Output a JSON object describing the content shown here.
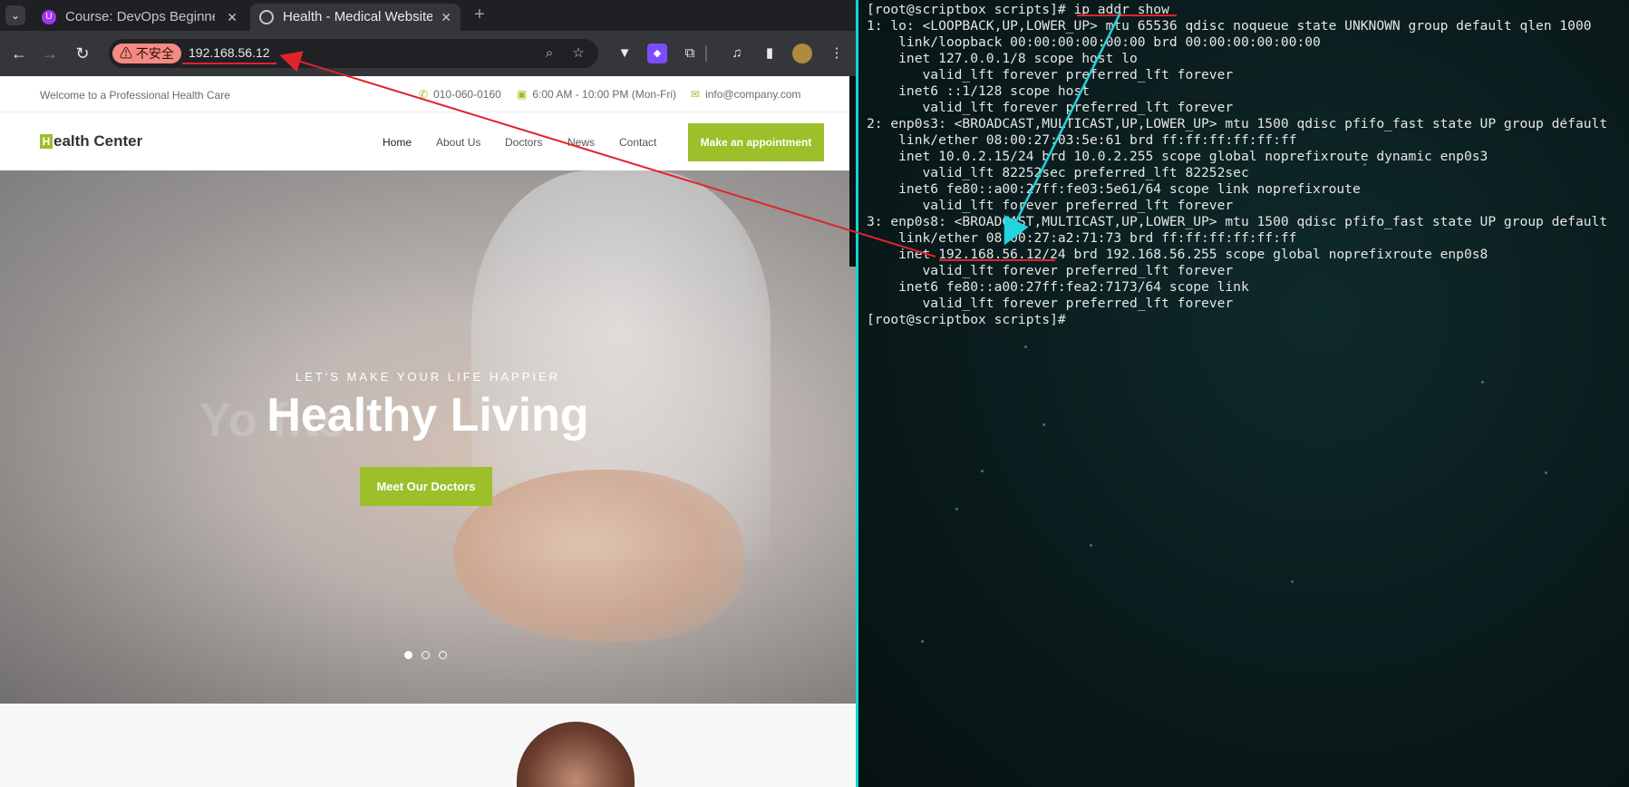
{
  "browser": {
    "tab_menu_icon": "chevron-down-icon",
    "tabs": [
      {
        "title": "Course: DevOps Beginne",
        "favicon": "udemy-icon",
        "close": "✕"
      },
      {
        "title": "Health - Medical Website",
        "favicon": "globe-icon",
        "close": "✕"
      }
    ],
    "new_tab_label": "+",
    "toolbar": {
      "back_icon": "←",
      "forward_icon": "→",
      "reload_icon": "↻",
      "security_label": "⚠ 不安全",
      "url": "192.168.56.12",
      "zoom_icon": "🔍",
      "bookmark_icon": "☆",
      "menu_icon": "⋮"
    }
  },
  "site": {
    "topbar": {
      "welcome": "Welcome to a Professional Health Care",
      "phone": "010-060-0160",
      "hours": "6:00 AM - 10:00 PM (Mon-Fri)",
      "email": "info@company.com"
    },
    "nav": {
      "brand_letter": "H",
      "brand_rest": "ealth Center",
      "links": [
        "Home",
        "About Us",
        "Doctors",
        "News",
        "Contact"
      ],
      "cta": "Make an appointment"
    },
    "hero": {
      "subtitle": "LET'S MAKE YOUR LIFE HAPPIER",
      "title": "Healthy Living",
      "ghost_text": "Yo                                  fits",
      "button": "Meet Our Doctors",
      "slides": 3,
      "active_slide": 1
    }
  },
  "terminal": {
    "lines": [
      "[root@scriptbox scripts]# ip addr show",
      "1: lo: <LOOPBACK,UP,LOWER_UP> mtu 65536 qdisc noqueue state UNKNOWN group default qlen 1000",
      "    link/loopback 00:00:00:00:00:00 brd 00:00:00:00:00:00",
      "    inet 127.0.0.1/8 scope host lo",
      "       valid_lft forever preferred_lft forever",
      "    inet6 ::1/128 scope host",
      "       valid_lft forever preferred_lft forever",
      "2: enp0s3: <BROADCAST,MULTICAST,UP,LOWER_UP> mtu 1500 qdisc pfifo_fast state UP group default",
      "    link/ether 08:00:27:03:5e:61 brd ff:ff:ff:ff:ff:ff",
      "    inet 10.0.2.15/24 brd 10.0.2.255 scope global noprefixroute dynamic enp0s3",
      "       valid_lft 82252sec preferred_lft 82252sec",
      "    inet6 fe80::a00:27ff:fe03:5e61/64 scope link noprefixroute",
      "       valid_lft forever preferred_lft forever",
      "3: enp0s8: <BROADCAST,MULTICAST,UP,LOWER_UP> mtu 1500 qdisc pfifo_fast state UP group default",
      "    link/ether 08:00:27:a2:71:73 brd ff:ff:ff:ff:ff:ff",
      "    inet 192.168.56.12/24 brd 192.168.56.255 scope global noprefixroute enp0s8",
      "       valid_lft forever preferred_lft forever",
      "    inet6 fe80::a00:27ff:fea2:7173/64 scope link",
      "       valid_lft forever preferred_lft forever",
      "[root@scriptbox scripts]#"
    ]
  },
  "colors": {
    "accent_green": "#9cbf2a",
    "annotation_red": "#e0242b",
    "annotation_cyan": "#22d3e0",
    "terminal_border": "#0fd7d0"
  }
}
